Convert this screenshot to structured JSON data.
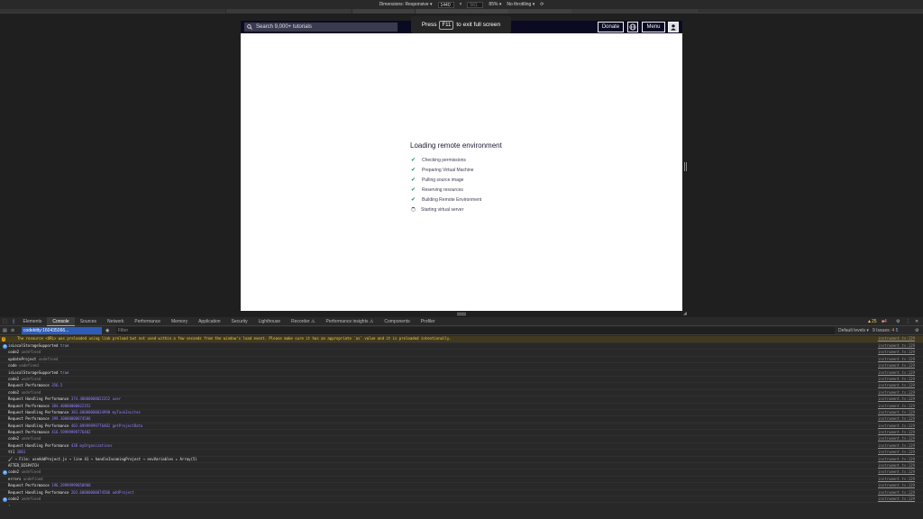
{
  "device_toolbar": {
    "dimensions_label": "Dimensions: Responsive",
    "width_value": "1440",
    "height_placeholder": "561",
    "zoom": "85%",
    "throttling": "No throttling"
  },
  "site": {
    "search_placeholder": "Search 9,000+ tutorials",
    "donate": "Donate",
    "menu": "Menu"
  },
  "toast": {
    "prefix": "Press",
    "key": "F11",
    "suffix": "to exit full screen"
  },
  "loader": {
    "title": "Loading remote environment",
    "steps": [
      {
        "label": "Checking permissions",
        "done": true
      },
      {
        "label": "Preparing Virtual Machine",
        "done": true
      },
      {
        "label": "Pulling source image",
        "done": true
      },
      {
        "label": "Reserving resources",
        "done": true
      },
      {
        "label": "Building Remote Environment",
        "done": true
      },
      {
        "label": "Starting virtual server",
        "done": false
      }
    ]
  },
  "devtools": {
    "tabs": [
      "Elements",
      "Console",
      "Sources",
      "Network",
      "Performance",
      "Memory",
      "Application",
      "Security",
      "Lighthouse",
      "Recorder ⚠",
      "Performance insights ⚠",
      "Components",
      "Profiler"
    ],
    "active_tab": "Console",
    "context": "codekitty:160435066...",
    "filter_placeholder": "Filter",
    "default_levels": "Default levels ▾",
    "issues": "9 Issues:",
    "issues_red": "4",
    "issues_blue": "5",
    "warn_count": "25",
    "err_count": "4"
  },
  "console": {
    "warning": {
      "count": "2",
      "text": "The resource <URL> was preloaded using link preload but not used within a few seconds from the window's load event. Please make sure it has an appropriate `as` value and it is preloaded intentionally."
    },
    "source": "instrument.ts:129",
    "rows": [
      {
        "badge": "2",
        "key": "isLocalStorageSupported",
        "val": "true",
        "cls": "blue"
      },
      {
        "badge": "",
        "key": "code2",
        "val": "undefined",
        "cls": "gray"
      },
      {
        "badge": "",
        "key": "updateProject",
        "val": "undefined",
        "cls": "gray"
      },
      {
        "badge": "",
        "key": "code",
        "val": "undefined",
        "cls": "gray"
      },
      {
        "badge": "",
        "key": "isLocalStorageSupported",
        "val": "true",
        "cls": "blue"
      },
      {
        "badge": "",
        "key": "code2",
        "val": "undefined",
        "cls": "gray"
      },
      {
        "badge": "",
        "key": "Request Performance",
        "val": "356.5",
        "cls": "num"
      },
      {
        "badge": "",
        "key": "code2",
        "val": "undefined",
        "cls": "gray"
      },
      {
        "badge": "",
        "key": "Request Handling Performance",
        "val": "374.40000000022352 user",
        "cls": "num"
      },
      {
        "badge": "",
        "key": "Request Performance",
        "val": "384.40000000022352",
        "cls": "num"
      },
      {
        "badge": "",
        "key": "Request Handling Performance",
        "val": "383.60000000034998 myTaskInvites",
        "cls": "num"
      },
      {
        "badge": "",
        "key": "Request Performance",
        "val": "399.30000000074506",
        "cls": "num"
      },
      {
        "badge": "",
        "key": "Request Handling Performance",
        "val": "403.09999999776482 getProjectData",
        "cls": "num"
      },
      {
        "badge": "",
        "key": "Request Performance",
        "val": "416.59999999776482",
        "cls": "num"
      },
      {
        "badge": "",
        "key": "code2",
        "val": "undefined",
        "cls": "gray"
      },
      {
        "badge": "",
        "key": "Request Handling Performance",
        "val": "438 myOrganizations",
        "cls": "num"
      },
      {
        "badge": "",
        "key": "tt1",
        "val": "3061",
        "cls": "num"
      },
      {
        "badge": "",
        "key": "🖌 → File: useAddProject.js → line 41 → handleIncomingProject → envVariables ▸",
        "val": "Array(5)",
        "cls": ""
      },
      {
        "badge": "",
        "key": "AFTER_DISPATCH",
        "val": "",
        "cls": ""
      },
      {
        "badge": "2",
        "key": "code2",
        "val": "undefined",
        "cls": "gray"
      },
      {
        "badge": "",
        "key": "errors",
        "val": "undefined",
        "cls": "gray"
      },
      {
        "badge": "",
        "key": "Request Performance",
        "val": "196.29999999850988",
        "cls": "num"
      },
      {
        "badge": "",
        "key": "Request Handling Performance",
        "val": "203.60000000074506 addProject",
        "cls": "num"
      },
      {
        "badge": "2",
        "key": "code2",
        "val": "undefined",
        "cls": "gray"
      }
    ]
  }
}
